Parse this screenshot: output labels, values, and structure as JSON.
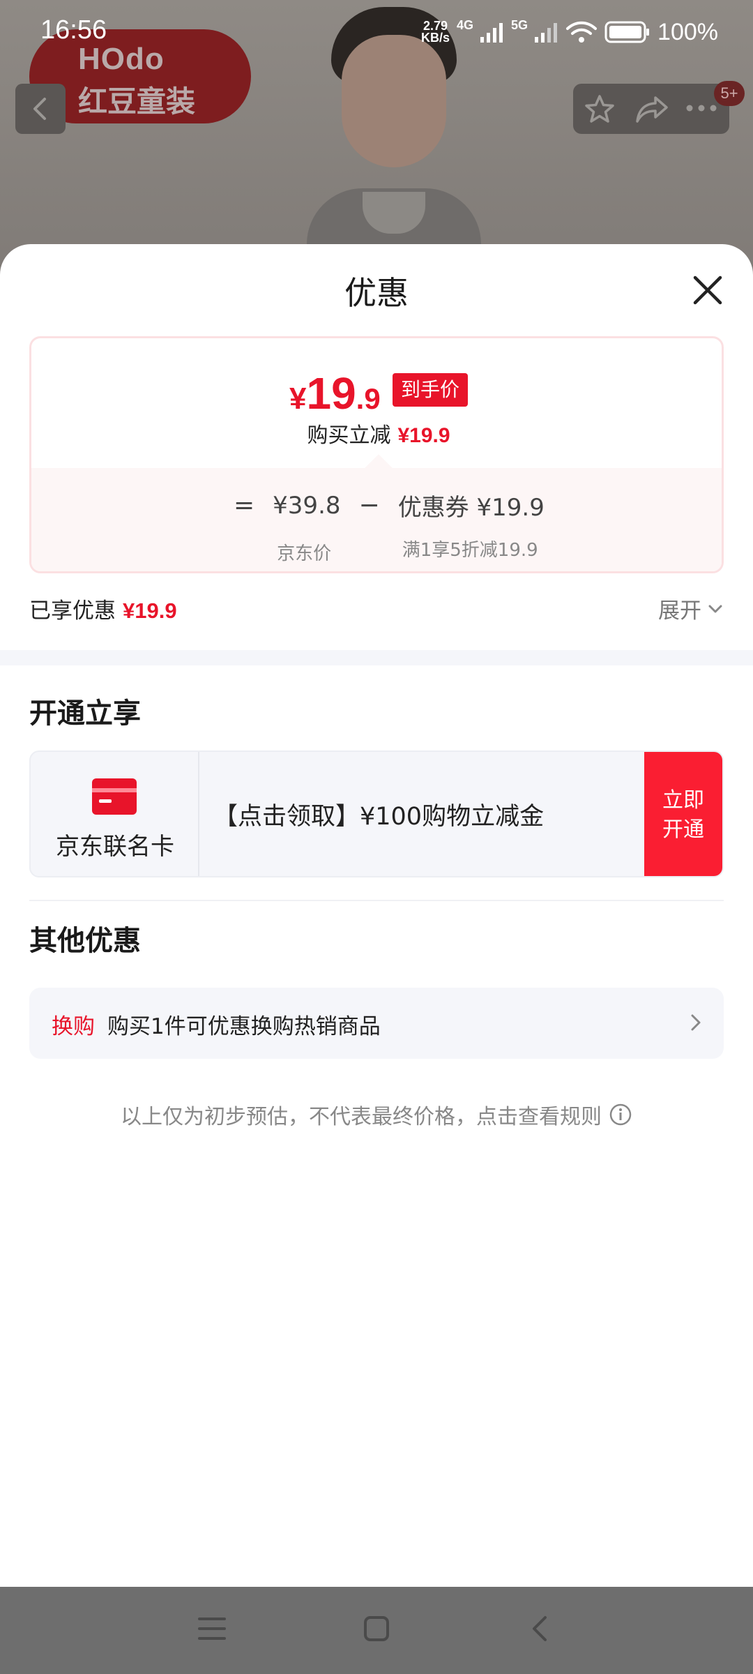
{
  "status_bar": {
    "time": "16:56",
    "speed_value": "2.79",
    "speed_unit": "KB/s",
    "net1": "4G",
    "net2": "5G",
    "battery": "100%"
  },
  "background": {
    "logo_top": "HOdo",
    "logo_bottom": "红豆童装",
    "cart_badge": "5+"
  },
  "sheet": {
    "title": "优惠",
    "price_card": {
      "yen": "¥",
      "price_int": "19",
      "price_dec": ".9",
      "price_tag": "到手价",
      "reduce_label": "购买立减",
      "reduce_value": "¥19.9",
      "eq": "=",
      "minus": "−",
      "jd_price": "¥39.8",
      "jd_price_label": "京东价",
      "coupon": "优惠券 ¥19.9",
      "coupon_label": "满1享5折减19.9"
    },
    "enjoyed_label": "已享优惠",
    "enjoyed_value": "¥19.9",
    "expand_label": "展开",
    "open_section": {
      "title": "开通立享",
      "card_name": "京东联名卡",
      "card_text": "【点击领取】¥100购物立减金",
      "button": "立即 开通",
      "button_line1": "立即",
      "button_line2": "开通"
    },
    "other_section": {
      "title": "其他优惠",
      "tag": "换购",
      "text": "购买1件可优惠换购热销商品"
    },
    "disclaimer": "以上仅为初步预估，不代表最终价格，点击查看规则"
  },
  "colors": {
    "accent_red": "#e8142a",
    "button_red": "#fa1e32"
  }
}
